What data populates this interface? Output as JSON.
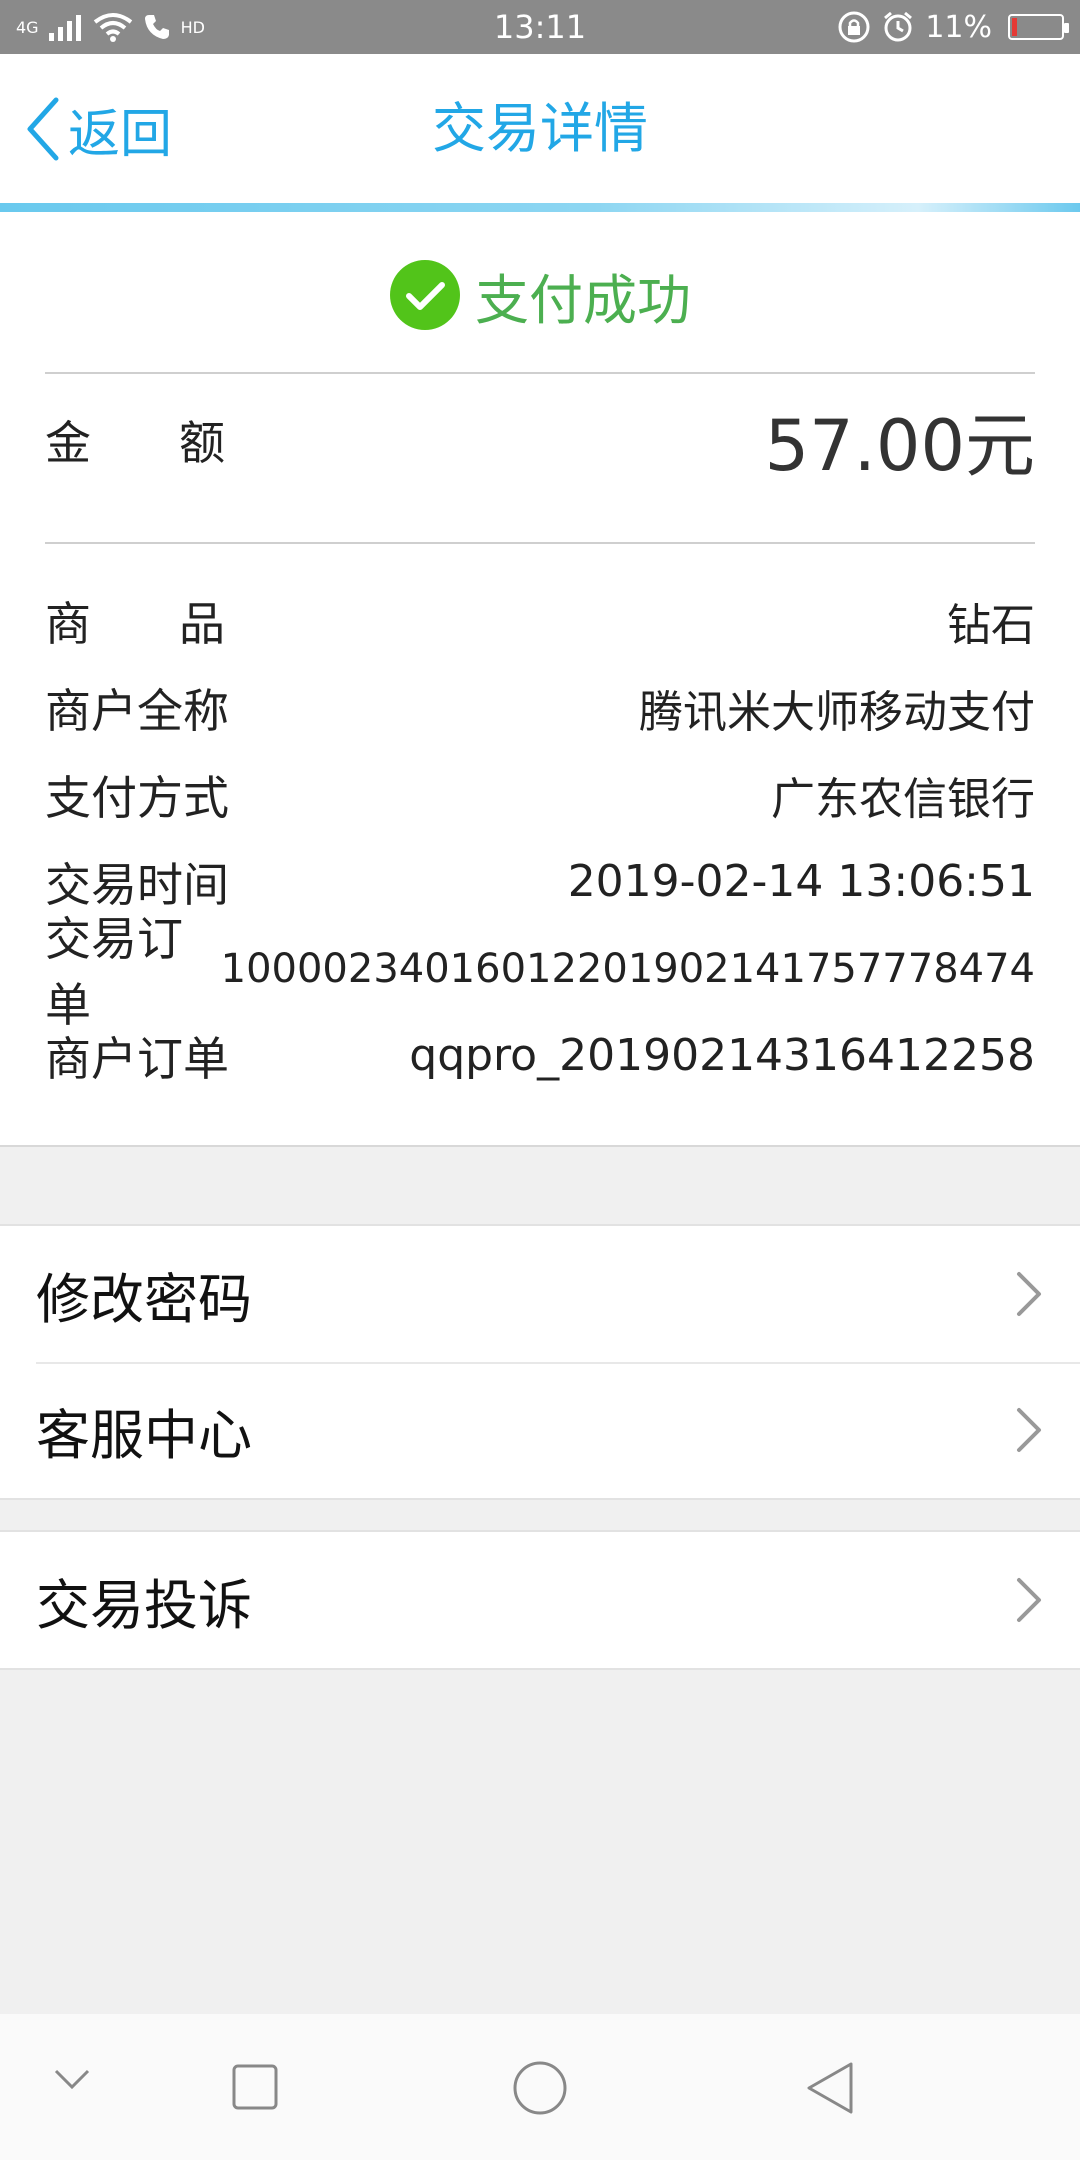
{
  "status_bar": {
    "network": "4G",
    "hd": "HD",
    "time": "13:11",
    "battery_percent": "11%",
    "battery_level": 0.11
  },
  "header": {
    "back_label": "返回",
    "title": "交易详情"
  },
  "details": {
    "status_text": "支付成功",
    "amount_label_chars": [
      "金",
      "额"
    ],
    "amount_value": "57.00元",
    "rows": [
      {
        "label_chars": [
          "商",
          "品"
        ],
        "value": "钻石"
      },
      {
        "label": "商户全称",
        "value": "腾讯米大师移动支付"
      },
      {
        "label": "支付方式",
        "value": "广东农信银行"
      },
      {
        "label": "交易时间",
        "value": "2019-02-14 13:06:51"
      },
      {
        "label": "交易订单",
        "value": "10000234016012201902141757778474"
      },
      {
        "label": "商户订单",
        "value": "qqpro_20190214316412258"
      }
    ]
  },
  "menu": {
    "group1": [
      {
        "label": "修改密码"
      },
      {
        "label": "客服中心"
      }
    ],
    "group2": [
      {
        "label": "交易投诉"
      }
    ]
  },
  "colors": {
    "accent": "#22a7e6",
    "success": "#4caf50",
    "status_bar": "#8a8a8a",
    "battery_low": "#e53935"
  }
}
